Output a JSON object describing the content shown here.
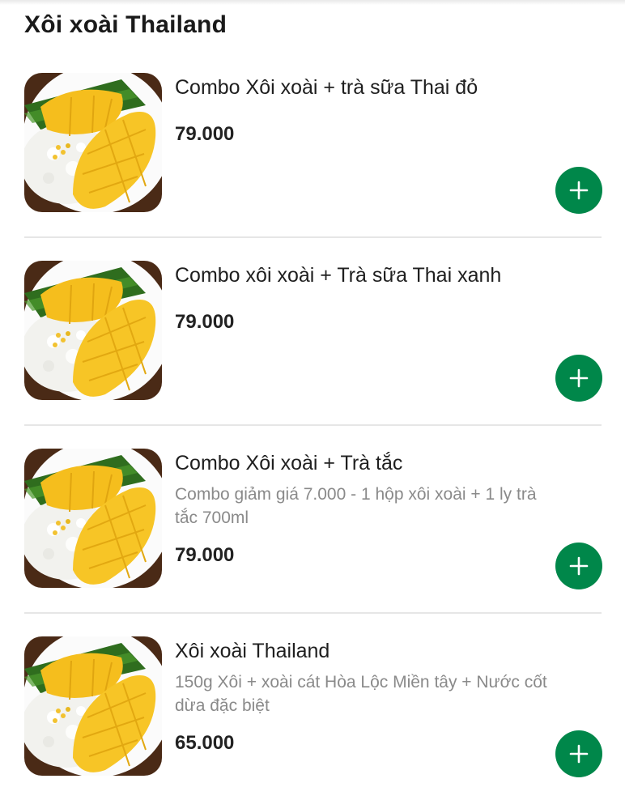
{
  "section": {
    "title": "Xôi xoài Thailand"
  },
  "items": [
    {
      "name": "Combo Xôi xoài + trà sữa Thai đỏ",
      "description": "",
      "price": "79.000",
      "add_icon": "plus-icon",
      "image": "mango-sticky-rice-photo"
    },
    {
      "name": "Combo xôi xoài + Trà sữa Thai xanh",
      "description": "",
      "price": "79.000",
      "add_icon": "plus-icon",
      "image": "mango-sticky-rice-photo"
    },
    {
      "name": "Combo Xôi xoài + Trà tắc",
      "description": "Combo giảm giá 7.000 -  1 hộp xôi xoài + 1 ly trà tắc 700ml",
      "price": "79.000",
      "add_icon": "plus-icon",
      "image": "mango-sticky-rice-photo"
    },
    {
      "name": "Xôi xoài Thailand",
      "description": "150g Xôi + xoài cát Hòa Lộc Miền tây + Nước cốt dừa đặc biệt",
      "price": "65.000",
      "add_icon": "plus-icon",
      "image": "mango-sticky-rice-photo"
    }
  ],
  "colors": {
    "accent": "#00874a",
    "divider": "#e6e6e6",
    "muted_text": "#8a8a8a"
  }
}
